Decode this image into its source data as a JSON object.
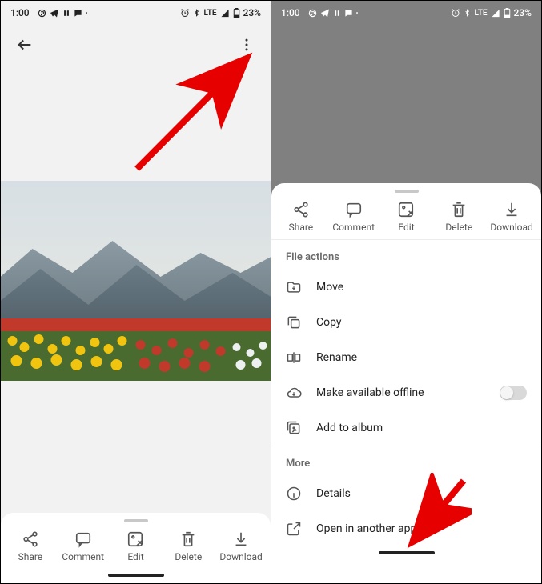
{
  "status": {
    "time": "1:00",
    "battery": "23%",
    "network": "LTE"
  },
  "toolbar": {
    "share": "Share",
    "comment": "Comment",
    "edit": "Edit",
    "delete": "Delete",
    "download": "Download"
  },
  "sheet": {
    "fileActionsHeader": "File actions",
    "move": "Move",
    "copy": "Copy",
    "rename": "Rename",
    "offline": "Make available offline",
    "addToAlbum": "Add to album",
    "moreHeader": "More",
    "details": "Details",
    "openInApp": "Open in another app"
  }
}
